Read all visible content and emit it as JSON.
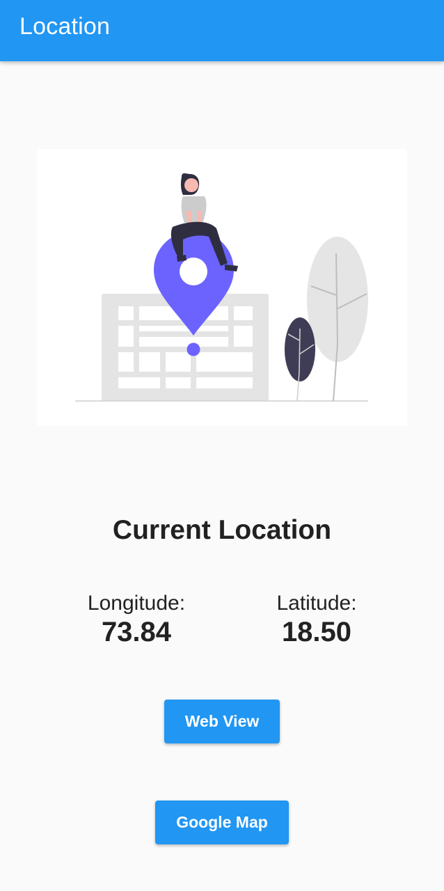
{
  "app_bar": {
    "title": "Location"
  },
  "illustration": {
    "icon": "location-illustration",
    "accent_color": "#6c63ff"
  },
  "main": {
    "heading": "Current Location",
    "longitude": {
      "label": "Longitude:",
      "value": "73.84"
    },
    "latitude": {
      "label": "Latitude:",
      "value": "18.50"
    }
  },
  "buttons": {
    "web_view": "Web View",
    "google_map": "Google Map"
  },
  "colors": {
    "primary": "#2196f3",
    "background": "#fafafa",
    "text": "#212121"
  }
}
